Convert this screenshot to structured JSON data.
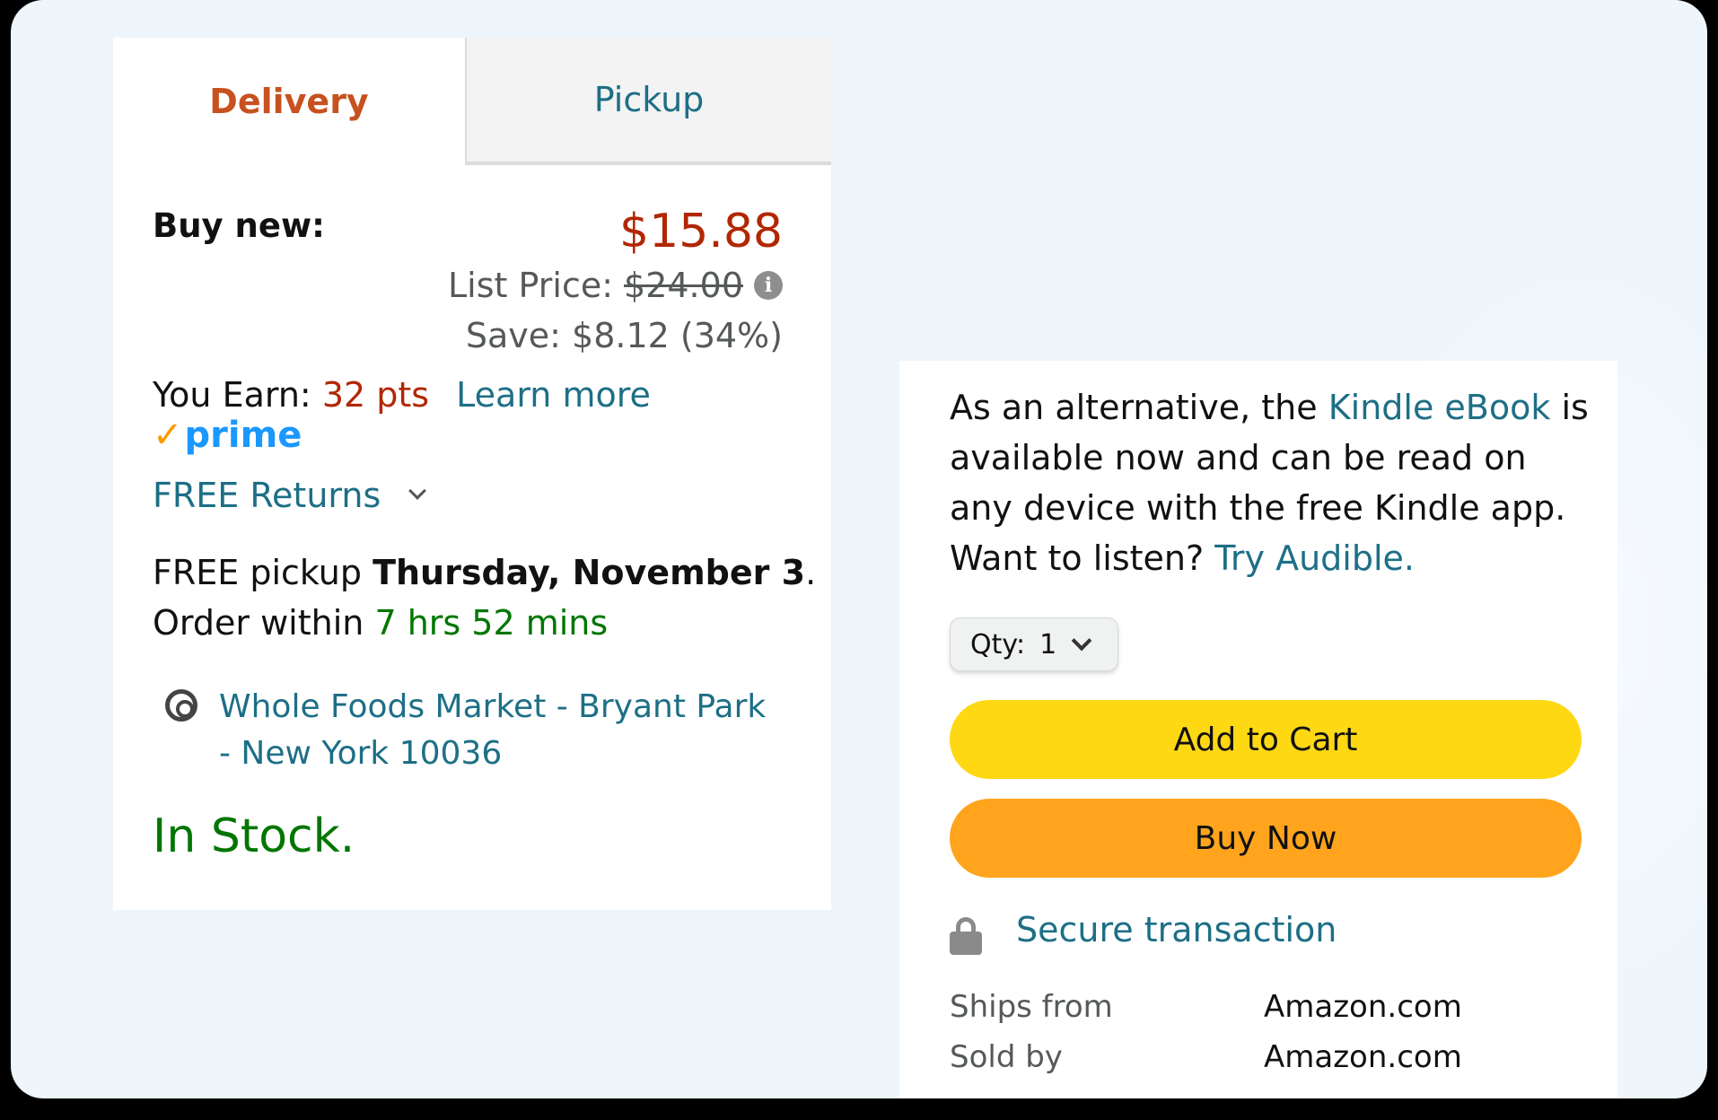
{
  "tabs": {
    "delivery": "Delivery",
    "pickup": "Pickup"
  },
  "buy_box": {
    "buy_new_label": "Buy new:",
    "price": "$15.88",
    "list_price_label": "List Price:",
    "list_price": "$24.00",
    "save": "Save: $8.12 (34%)",
    "earn_label": "You Earn:",
    "earn_points": "32 pts",
    "learn_more": "Learn more",
    "prime": "prime",
    "free_returns": "FREE Returns",
    "pickup_prefix": "FREE pickup",
    "pickup_date": "Thursday, November 3",
    "pickup_suffix": ".",
    "order_within_label": "Order within",
    "order_within_time": "7 hrs 52 mins",
    "location": "Whole Foods Market - Bryant Park - New York 10036",
    "stock": "In Stock."
  },
  "purchase": {
    "alt_text_1": "As an alternative, the",
    "kindle_link": "Kindle eBook",
    "alt_text_2": "is available now and can be read on any device with the free Kindle app. Want to listen?",
    "audible_link": "Try Audible.",
    "qty_label": "Qty:",
    "qty_value": "1",
    "add_to_cart": "Add to Cart",
    "buy_now": "Buy Now",
    "secure": "Secure transaction",
    "ships_from_label": "Ships from",
    "ships_from_value": "Amazon.com",
    "sold_by_label": "Sold by",
    "sold_by_value": "Amazon.com"
  },
  "colors": {
    "price_red": "#b12704",
    "link_teal": "#1d6f86",
    "delivery_orange": "#c7511f",
    "stock_green": "#007600",
    "cart_yellow": "#ffd814",
    "buy_orange": "#ffa41c",
    "prime_blue": "#1a98ff"
  },
  "icons": [
    "info-icon",
    "prime-check-icon",
    "chevron-down-icon",
    "location-pin-icon",
    "lock-icon"
  ]
}
